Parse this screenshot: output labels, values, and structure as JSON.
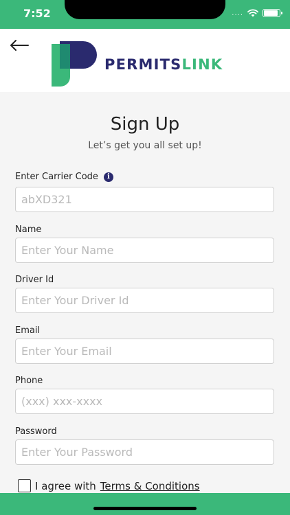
{
  "status_bar": {
    "time": "7:52",
    "signal": "...."
  },
  "header": {
    "brand_part1": "PERMITS",
    "brand_part2": "LINK"
  },
  "form": {
    "title": "Sign Up",
    "subtitle": "Let’s get you all set up!",
    "carrier_code": {
      "label": "Enter Carrier Code",
      "info": "i",
      "placeholder": "abXD321"
    },
    "name": {
      "label": "Name",
      "placeholder": "Enter Your Name"
    },
    "driver_id": {
      "label": "Driver Id",
      "placeholder": "Enter Your Driver Id"
    },
    "email": {
      "label": "Email",
      "placeholder": "Enter Your Email"
    },
    "phone": {
      "label": "Phone",
      "placeholder": "(xxx) xxx-xxxx"
    },
    "password": {
      "label": "Password",
      "placeholder": "Enter Your Password"
    },
    "agree": {
      "prefix": "I agree with",
      "link": "Terms & Conditions"
    }
  },
  "colors": {
    "brand_green": "#3bb87a",
    "brand_navy": "#2a2a6e",
    "logo_teal": "#1f8a70"
  }
}
